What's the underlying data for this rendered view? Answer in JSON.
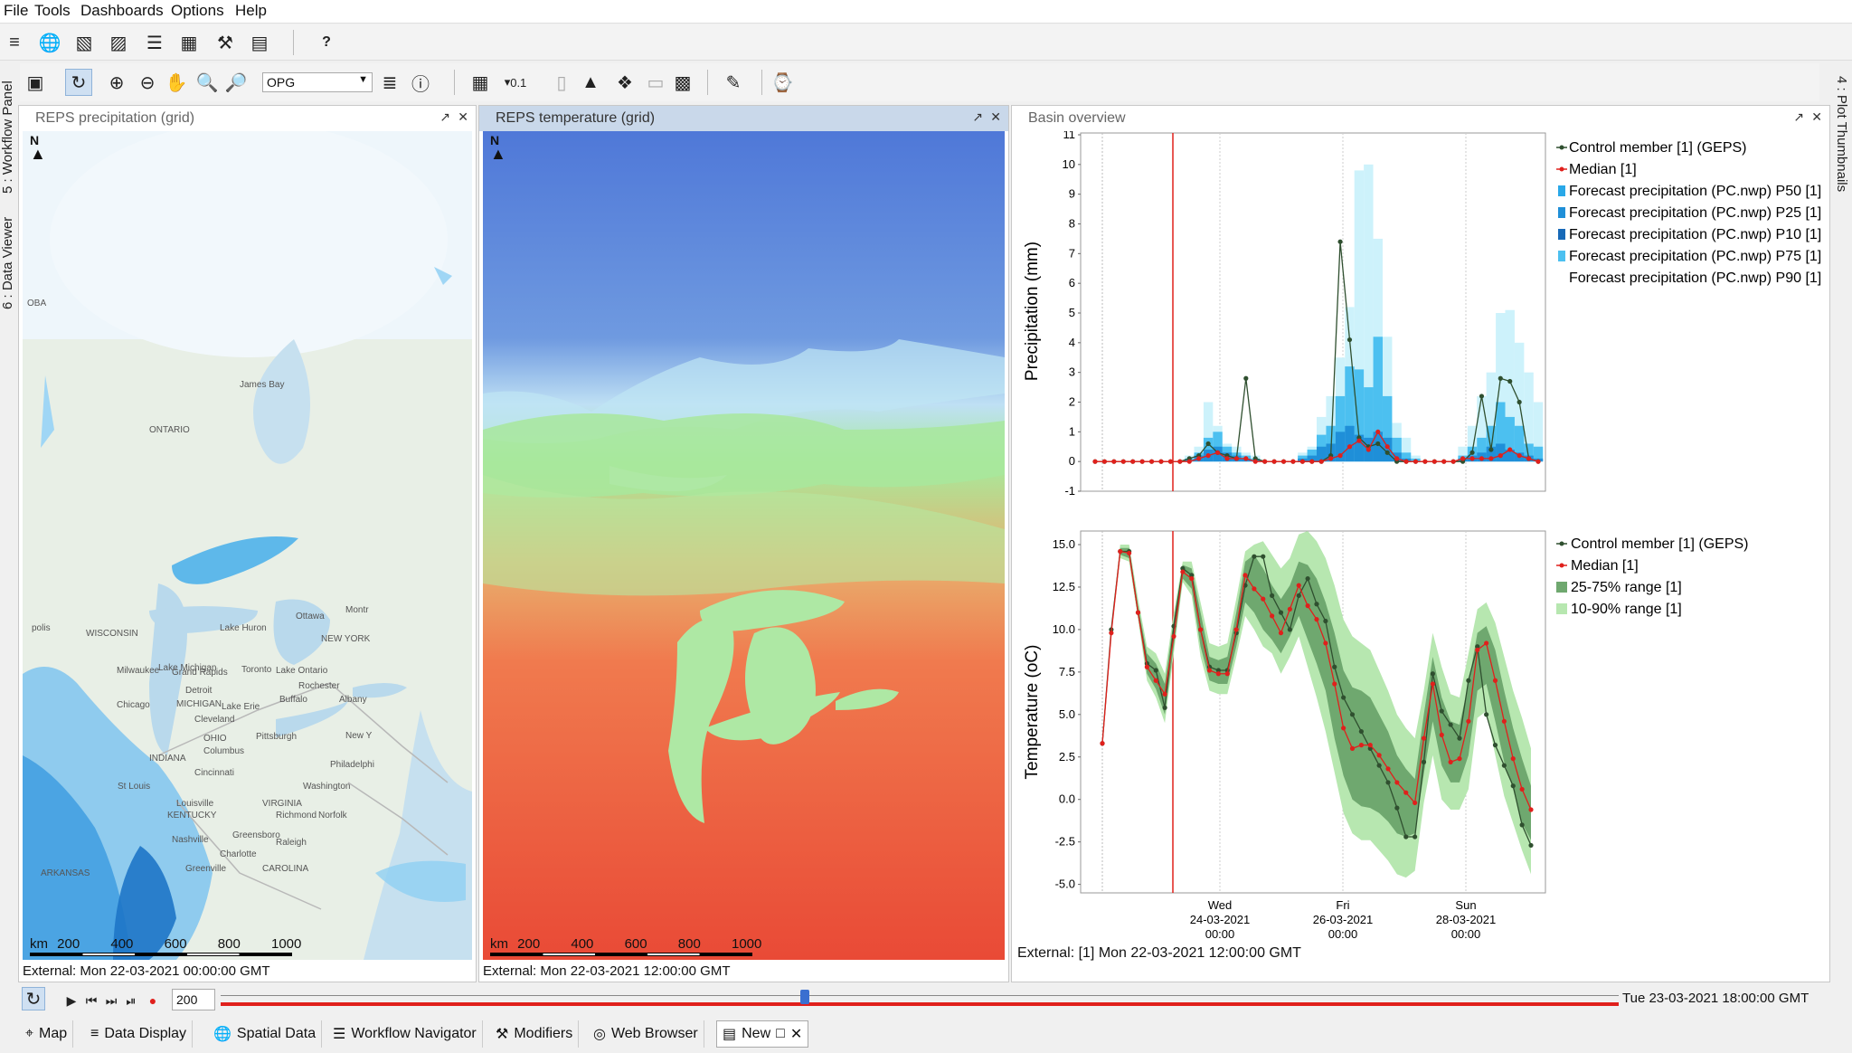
{
  "menu": [
    "File",
    "Tools",
    "Dashboards",
    "Options",
    "Help"
  ],
  "toolbar": {
    "help_label": "?",
    "search_value": "OPG",
    "layer_label": "0.1"
  },
  "side_tabs": {
    "workflow": "5 : Workflow Panel",
    "data_viewer": "6 : Data Viewer",
    "plot_thumbnails": "4 : Plot Thumbnails"
  },
  "panels": {
    "precip": {
      "title": "REPS precipitation (grid)",
      "status": "External: Mon 22-03-2021 00:00:00 GMT",
      "north": "N",
      "places": [
        {
          "name": "ONTARIO"
        },
        {
          "name": "James Bay"
        },
        {
          "name": "Lake Michigan"
        },
        {
          "name": "Lake Huron"
        },
        {
          "name": "Ottawa"
        },
        {
          "name": "Toronto"
        },
        {
          "name": "Lake Ontario"
        },
        {
          "name": "Rochester"
        },
        {
          "name": "Buffalo"
        },
        {
          "name": "Albany"
        },
        {
          "name": "Lake Erie"
        },
        {
          "name": "Milwaukee"
        },
        {
          "name": "Grand Rapids"
        },
        {
          "name": "Detroit"
        },
        {
          "name": "MICHIGAN"
        },
        {
          "name": "Chicago"
        },
        {
          "name": "Cleveland"
        },
        {
          "name": "OHIO"
        },
        {
          "name": "Columbus"
        },
        {
          "name": "Pittsburgh"
        },
        {
          "name": "New Y"
        },
        {
          "name": "Philadelphi"
        },
        {
          "name": "Washington"
        },
        {
          "name": "Cincinnati"
        },
        {
          "name": "INDIANA"
        },
        {
          "name": "St Louis"
        },
        {
          "name": "Louisville"
        },
        {
          "name": "KENTUCKY"
        },
        {
          "name": "VIRGINIA"
        },
        {
          "name": "Richmond"
        },
        {
          "name": "Norfolk"
        },
        {
          "name": "Greensboro"
        },
        {
          "name": "Raleigh"
        },
        {
          "name": "Charlotte"
        },
        {
          "name": "Greenville"
        },
        {
          "name": "ARKANSAS"
        },
        {
          "name": "Nashville"
        },
        {
          "name": "CAROLINA"
        },
        {
          "name": "NEW YORK"
        },
        {
          "name": "WISCONSIN"
        },
        {
          "name": "Montr"
        },
        {
          "name": "OBA"
        },
        {
          "name": "polis"
        }
      ]
    },
    "temp": {
      "title": "REPS temperature (grid)",
      "status": "External: Mon 22-03-2021 12:00:00 GMT",
      "north": "N"
    },
    "basin": {
      "title": "Basin overview",
      "status": "External: [1] Mon 22-03-2021 12:00:00 GMT"
    }
  },
  "scalebar": {
    "unit": "km",
    "ticks": [
      "200",
      "400",
      "600",
      "800",
      "1000"
    ]
  },
  "chart_data": [
    {
      "type": "bar",
      "ylabel": "Precipitation (mm)",
      "ylim": [
        -1,
        11
      ],
      "yticks": [
        "11",
        "10",
        "9",
        "8",
        "7",
        "6",
        "5",
        "4",
        "3",
        "2",
        "1",
        "0",
        "-1"
      ],
      "legend": [
        {
          "label": "Control member [1]  (GEPS)",
          "color": "#2f4f2f",
          "kind": "line-dot"
        },
        {
          "label": "Median [1]",
          "color": "#e0201c",
          "kind": "line-dot"
        },
        {
          "label": "Forecast precipitation (PC.nwp) P50 [1]",
          "color": "#29a8e8",
          "kind": "box"
        },
        {
          "label": "Forecast precipitation (PC.nwp) P25 [1]",
          "color": "#1f8fd8",
          "kind": "box"
        },
        {
          "label": "Forecast precipitation (PC.nwp) P10 [1]",
          "color": "#1769b8",
          "kind": "box"
        },
        {
          "label": "Forecast precipitation (PC.nwp) P75 [1]",
          "color": "#4cc0f0",
          "kind": "box"
        },
        {
          "label": "Forecast precipitation (PC.nwp) P90 [1]",
          "color": "#ffffff",
          "kind": "none"
        }
      ],
      "series": [
        {
          "name": "Forecast precipitation (PC.nwp) P90 [1]",
          "color": "#cdf2fb",
          "values": [
            0,
            0,
            0,
            0,
            0,
            0,
            0,
            0,
            0,
            0,
            0.2,
            0.5,
            2,
            1.2,
            0.6,
            0.5,
            0.3,
            0.2,
            0,
            0,
            0,
            0,
            0.3,
            0.5,
            1.5,
            2.2,
            3.5,
            5.2,
            9.8,
            10,
            7.5,
            4.2,
            1.3,
            0.8,
            0.2,
            0,
            0,
            0,
            0,
            0.5,
            1.2,
            2.2,
            3,
            5,
            5.1,
            4,
            3,
            2
          ]
        },
        {
          "name": "Forecast precipitation (PC.nwp) P75 [1]",
          "color": "#4cc0f0",
          "values": [
            0,
            0,
            0,
            0,
            0,
            0,
            0,
            0,
            0,
            0,
            0.1,
            0.3,
            0.8,
            1,
            0.5,
            0.3,
            0.2,
            0.1,
            0,
            0,
            0,
            0,
            0.2,
            0.4,
            0.9,
            1.2,
            2.2,
            3.2,
            3.1,
            2.5,
            4.2,
            2.2,
            0.8,
            0.3,
            0.1,
            0,
            0,
            0,
            0,
            0.2,
            0.5,
            0.8,
            1.2,
            2,
            1.5,
            1.2,
            0.6,
            0.5
          ]
        },
        {
          "name": "Forecast precipitation (PC.nwp) P50 [1]",
          "color": "#1f8fd8",
          "values": [
            0,
            0,
            0,
            0,
            0,
            0,
            0,
            0,
            0,
            0,
            0.05,
            0.2,
            0.4,
            0.5,
            0.3,
            0.2,
            0.1,
            0.05,
            0,
            0,
            0,
            0,
            0.1,
            0.2,
            0.5,
            0.6,
            1,
            1.2,
            0.9,
            0.8,
            1,
            0.8,
            0.3,
            0.1,
            0,
            0,
            0,
            0,
            0,
            0.1,
            0.2,
            0.3,
            0.5,
            0.6,
            0.4,
            0.3,
            0.2,
            0.1
          ]
        },
        {
          "name": "Control member [1]  (GEPS)",
          "color": "#2f4f2f",
          "kind": "line",
          "values": [
            0,
            0,
            0,
            0,
            0,
            0,
            0,
            0,
            0,
            0,
            0.1,
            0.2,
            0.6,
            0.3,
            0.2,
            0.1,
            2.8,
            0.1,
            0,
            0,
            0,
            0,
            0,
            0,
            0,
            0.2,
            7.4,
            4.1,
            0.8,
            0.5,
            0.6,
            0.3,
            0,
            0,
            0,
            0,
            0,
            0,
            0,
            0,
            0.3,
            2.2,
            0.4,
            2.8,
            2.7,
            2.0,
            0.1,
            0
          ]
        },
        {
          "name": "Median [1]",
          "color": "#e0201c",
          "kind": "line",
          "values": [
            0,
            0,
            0,
            0,
            0,
            0,
            0,
            0,
            0,
            0,
            0,
            0.1,
            0.2,
            0.3,
            0.1,
            0.1,
            0.1,
            0,
            0,
            0,
            0,
            0,
            0,
            0,
            0,
            0.1,
            0.2,
            0.5,
            0.7,
            0.4,
            1.0,
            0.5,
            0.1,
            0,
            0,
            0,
            0,
            0,
            0,
            0.1,
            0.1,
            0.1,
            0.1,
            0.2,
            0.4,
            0.2,
            0.1,
            0
          ]
        }
      ]
    },
    {
      "type": "line",
      "ylabel": "Temperature (oC)",
      "ylim": [
        -5.5,
        15.8
      ],
      "yticks": [
        "15.0",
        "12.5",
        "10.0",
        "7.5",
        "5.0",
        "2.5",
        "0.0",
        "-2.5",
        "-5.0"
      ],
      "xticks": [
        {
          "day": "Wed",
          "date": "24-03-2021",
          "time": "00:00"
        },
        {
          "day": "Fri",
          "date": "26-03-2021",
          "time": "00:00"
        },
        {
          "day": "Sun",
          "date": "28-03-2021",
          "time": "00:00"
        }
      ],
      "legend": [
        {
          "label": "Control member [1]  (GEPS)",
          "color": "#2f4f2f",
          "kind": "line-dot"
        },
        {
          "label": "Median [1]",
          "color": "#e0201c",
          "kind": "line-dot"
        },
        {
          "label": "25-75% range  [1]",
          "color": "#6fa86f",
          "kind": "box"
        },
        {
          "label": "10-90% range  [1]",
          "color": "#b7e7b0",
          "kind": "box"
        }
      ],
      "series": [
        {
          "name": "Control member [1]  (GEPS)",
          "color": "#2f4f2f",
          "values": [
            3.3,
            10.0,
            14.6,
            14.6,
            11.0,
            8.0,
            7.6,
            5.4,
            10.2,
            13.6,
            13.2,
            10.0,
            7.8,
            7.6,
            7.6,
            9.8,
            12.6,
            14.3,
            14.3,
            12.0,
            11.0,
            10.0,
            12.0,
            13.0,
            11.5,
            10.5,
            7.8,
            6.0,
            5.0,
            4.0,
            3.0,
            2.0,
            1.0,
            -0.5,
            -2.2,
            -2.2,
            2.2,
            7.4,
            5.2,
            4.4,
            3.6,
            7.0,
            9.0,
            5.0,
            3.2,
            2.0,
            0.8,
            -1.5,
            -2.7
          ]
        },
        {
          "name": "Median [1]",
          "color": "#e0201c",
          "values": [
            3.3,
            9.8,
            14.6,
            14.5,
            11.0,
            7.8,
            7.0,
            6.2,
            9.6,
            13.4,
            13.0,
            10.0,
            7.6,
            7.4,
            7.4,
            10.0,
            13.2,
            12.4,
            11.8,
            10.8,
            9.8,
            11.2,
            12.6,
            11.4,
            10.6,
            9.2,
            6.8,
            4.2,
            3.0,
            3.2,
            3.2,
            2.6,
            1.8,
            1.0,
            0.4,
            -0.2,
            3.6,
            6.8,
            3.8,
            2.2,
            2.4,
            4.6,
            8.8,
            9.2,
            7.0,
            4.6,
            2.4,
            0.6,
            -0.6
          ]
        },
        {
          "name": "25-75% range  [1]",
          "color": "#6fa86f",
          "lo": [
            3.3,
            9.8,
            14.4,
            14.2,
            10.8,
            7.4,
            6.5,
            5.0,
            9.0,
            13.0,
            12.4,
            9.0,
            7.0,
            6.8,
            6.8,
            9.0,
            11.6,
            11.0,
            10.0,
            9.4,
            8.6,
            9.6,
            10.8,
            9.4,
            8.0,
            6.4,
            3.6,
            1.4,
            0.0,
            -0.4,
            -0.5,
            -0.8,
            -1.3,
            -2.0,
            -2.2,
            -2.0,
            1.5,
            4.6,
            2.0,
            1.0,
            1.0,
            2.6,
            6.4,
            6.8,
            4.6,
            2.2,
            0.6,
            -1.4,
            -2.4
          ],
          "hi": [
            3.3,
            10.0,
            14.8,
            14.8,
            11.4,
            8.6,
            8.0,
            6.8,
            10.6,
            13.8,
            13.6,
            11.0,
            8.4,
            8.2,
            8.4,
            11.0,
            14.0,
            14.4,
            13.6,
            12.6,
            11.8,
            12.6,
            14.0,
            13.8,
            13.0,
            11.6,
            9.8,
            7.6,
            6.6,
            6.4,
            6.0,
            5.0,
            4.0,
            2.6,
            1.8,
            1.2,
            5.0,
            8.4,
            6.0,
            4.6,
            4.4,
            6.8,
            9.8,
            10.2,
            8.8,
            6.4,
            4.2,
            2.4,
            0.8
          ]
        },
        {
          "name": "10-90% range  [1]",
          "color": "#b7e7b0",
          "lo": [
            3.3,
            9.6,
            14.2,
            14.0,
            10.6,
            7.0,
            6.0,
            4.5,
            8.6,
            12.8,
            12.0,
            8.4,
            6.4,
            6.2,
            6.2,
            8.4,
            10.8,
            10.0,
            9.0,
            8.6,
            7.4,
            8.4,
            9.6,
            7.8,
            6.0,
            4.0,
            1.6,
            -0.8,
            -2.0,
            -2.4,
            -2.4,
            -3.0,
            -3.6,
            -4.4,
            -4.6,
            -4.2,
            -0.2,
            2.6,
            0.0,
            -0.6,
            -0.6,
            0.6,
            4.8,
            5.2,
            2.6,
            0.2,
            -1.4,
            -3.0,
            -4.4
          ],
          "hi": [
            3.3,
            10.2,
            15.0,
            15.0,
            11.8,
            9.0,
            8.6,
            7.4,
            11.0,
            14.0,
            14.0,
            11.6,
            9.2,
            9.0,
            9.2,
            11.8,
            14.6,
            15.0,
            15.2,
            14.4,
            13.6,
            14.2,
            15.6,
            15.8,
            15.2,
            14.2,
            12.6,
            10.6,
            9.6,
            9.2,
            8.8,
            7.6,
            6.4,
            5.0,
            4.2,
            3.6,
            6.4,
            9.8,
            7.8,
            6.2,
            6.0,
            8.6,
            11.2,
            11.6,
            10.4,
            8.4,
            6.4,
            4.8,
            3.0
          ]
        }
      ]
    }
  ],
  "timebar": {
    "step": "200",
    "end_label": "Tue 23-03-2021 18:00:00 GMT"
  },
  "bottom_tabs": [
    "Map",
    "Data Display",
    "Spatial Data",
    "Workflow Navigator",
    "Modifiers",
    "Web Browser",
    "New"
  ]
}
